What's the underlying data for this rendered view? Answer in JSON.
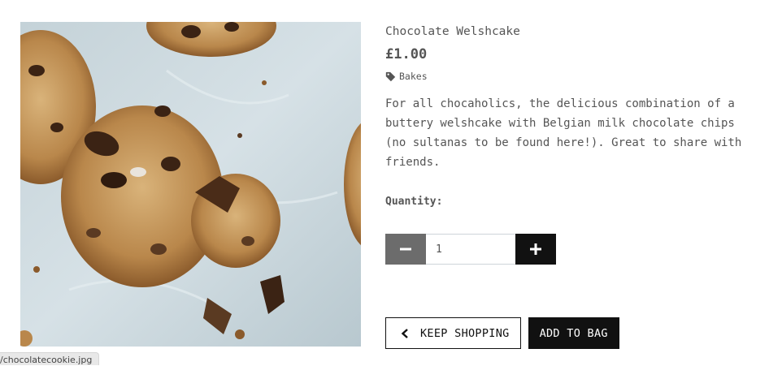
{
  "product": {
    "image_alt": "Chocolate Welshcake",
    "title": "Chocolate Welshcake",
    "price": "£1.00",
    "category": "Bakes",
    "category_icon": "tag-icon",
    "description": "For all chocaholics, the delicious combination of a buttery welshcake with Belgian milk chocolate chips (no sultanas to be found here!). Great to share with friends."
  },
  "quantity": {
    "label": "Quantity:",
    "value": "1",
    "minus_icon": "minus-icon",
    "plus_icon": "plus-icon"
  },
  "actions": {
    "keep_shopping_label": "KEEP SHOPPING",
    "add_to_bag_label": "ADD TO BAG"
  },
  "status_bar": {
    "url": "/chocolatecookie.jpg"
  },
  "colors": {
    "primary": "#111111",
    "muted_button": "#6c6c6c",
    "text": "#555555"
  }
}
